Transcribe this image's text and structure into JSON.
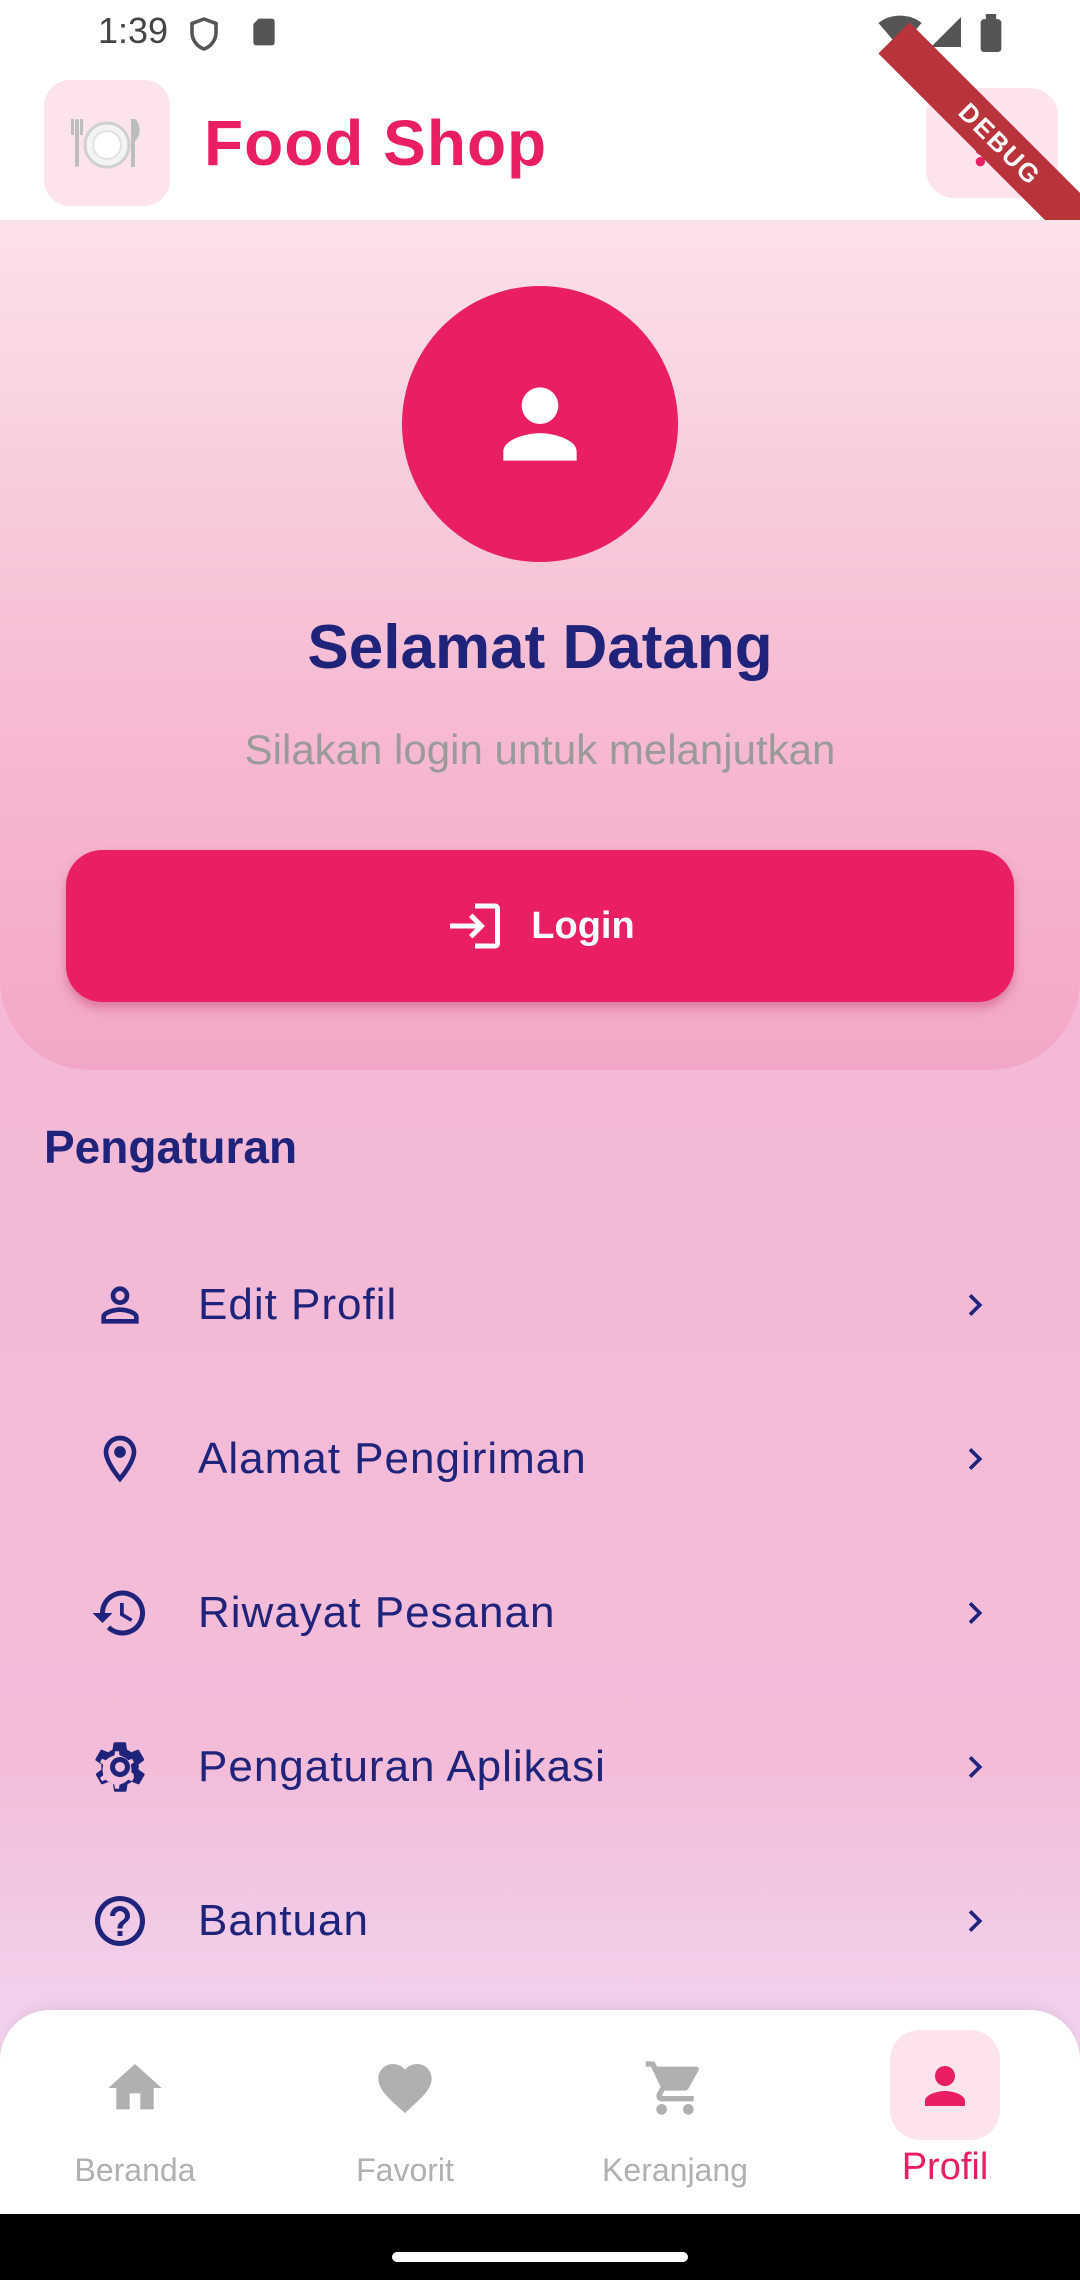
{
  "status_bar": {
    "time": "1:39"
  },
  "app_bar": {
    "title": "Food Shop",
    "logo_icon": "plate-cutlery-icon",
    "cart_icon": "cart-icon",
    "debug_banner": "DEBUG"
  },
  "profile": {
    "welcome": "Selamat Datang",
    "subtitle": "Silakan login untuk melanjutkan",
    "login_label": "Login"
  },
  "settings": {
    "title": "Pengaturan",
    "items": [
      {
        "label": "Edit Profil",
        "icon": "person-outline-icon"
      },
      {
        "label": "Alamat Pengiriman",
        "icon": "location-pin-icon"
      },
      {
        "label": "Riwayat Pesanan",
        "icon": "history-icon"
      },
      {
        "label": "Pengaturan Aplikasi",
        "icon": "gear-icon"
      },
      {
        "label": "Bantuan",
        "icon": "help-circle-icon"
      }
    ]
  },
  "bottom_nav": {
    "items": [
      {
        "label": "Beranda",
        "icon": "home-icon"
      },
      {
        "label": "Favorit",
        "icon": "heart-icon"
      },
      {
        "label": "Keranjang",
        "icon": "cart-icon"
      },
      {
        "label": "Profil",
        "icon": "person-icon",
        "active": true
      }
    ]
  },
  "colors": {
    "primary": "#e91e63",
    "text_dark": "#1f237a",
    "muted": "#9a9a9a",
    "inactive_nav": "#b0b0b0"
  }
}
